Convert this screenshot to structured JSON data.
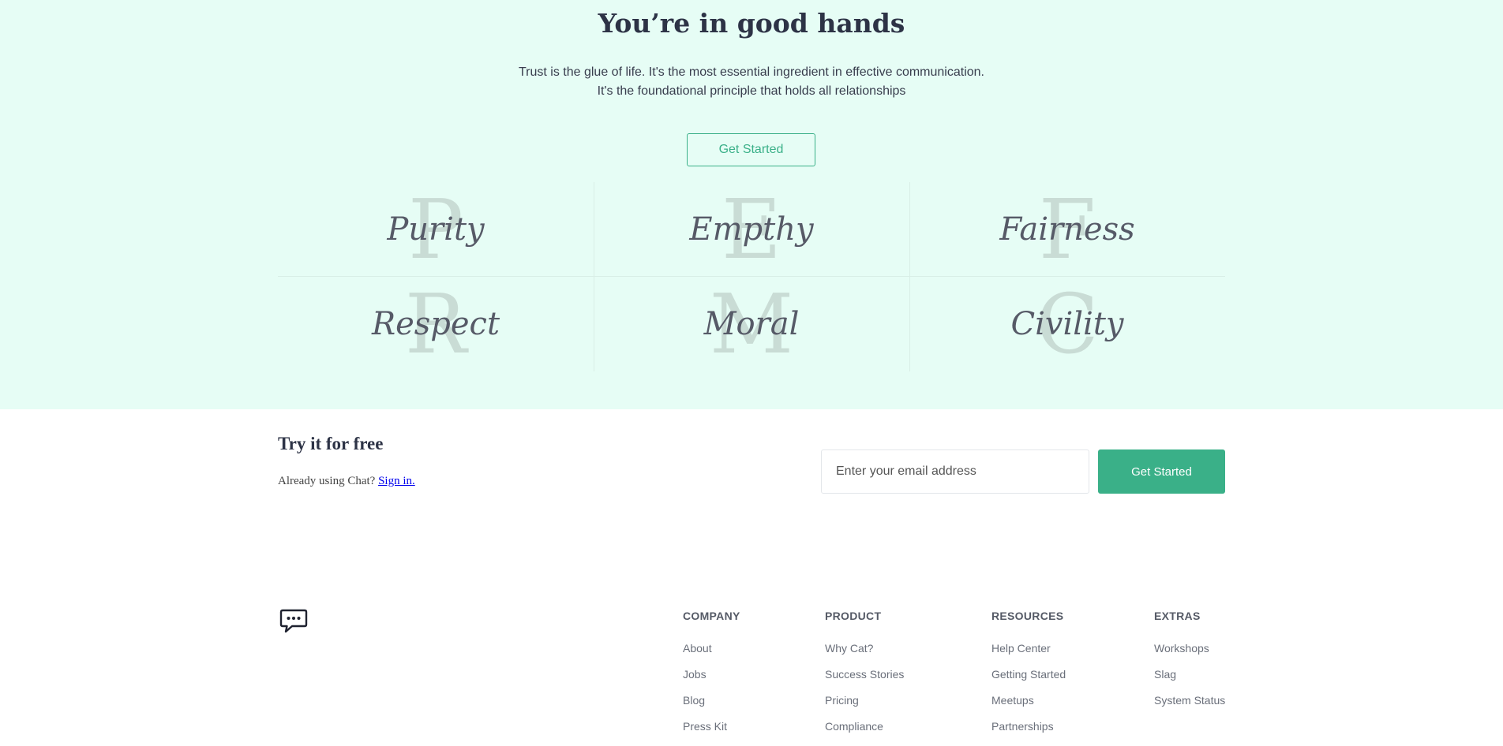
{
  "hero": {
    "title": "You’re in good hands",
    "text_line1": "Trust is the glue of life. It's the most essential ingredient in effective communication.",
    "text_line2": "It's the foundational principle that holds all relationships",
    "button_label": "Get Started"
  },
  "values": [
    {
      "letter": "P",
      "word": "Purity"
    },
    {
      "letter": "E",
      "word": "Empthy"
    },
    {
      "letter": "F",
      "word": "Fairness"
    },
    {
      "letter": "R",
      "word": "Respect"
    },
    {
      "letter": "M",
      "word": "Moral"
    },
    {
      "letter": "C",
      "word": "Civility"
    }
  ],
  "signup": {
    "title": "Try it for free",
    "subtitle": "Already using Chat?",
    "signin_link": "Sign in.",
    "email_placeholder": "Enter your email address",
    "button_label": "Get Started"
  },
  "footer": {
    "logo_icon": "chat-bubble-icon",
    "columns": [
      {
        "heading": "COMPANY",
        "links": [
          "About",
          "Jobs",
          "Blog",
          "Press Kit"
        ]
      },
      {
        "heading": "PRODUCT",
        "links": [
          "Why Cat?",
          "Success Stories",
          "Pricing",
          "Compliance"
        ]
      },
      {
        "heading": "RESOURCES",
        "links": [
          "Help Center",
          "Getting Started",
          "Meetups",
          "Partnerships"
        ]
      },
      {
        "heading": "EXTRAS",
        "links": [
          "Workshops",
          "Slag",
          "System Status"
        ]
      }
    ]
  },
  "colors": {
    "accent": "#3ab088",
    "hero_background": "#e6fdf5",
    "heading": "#2d3346"
  }
}
